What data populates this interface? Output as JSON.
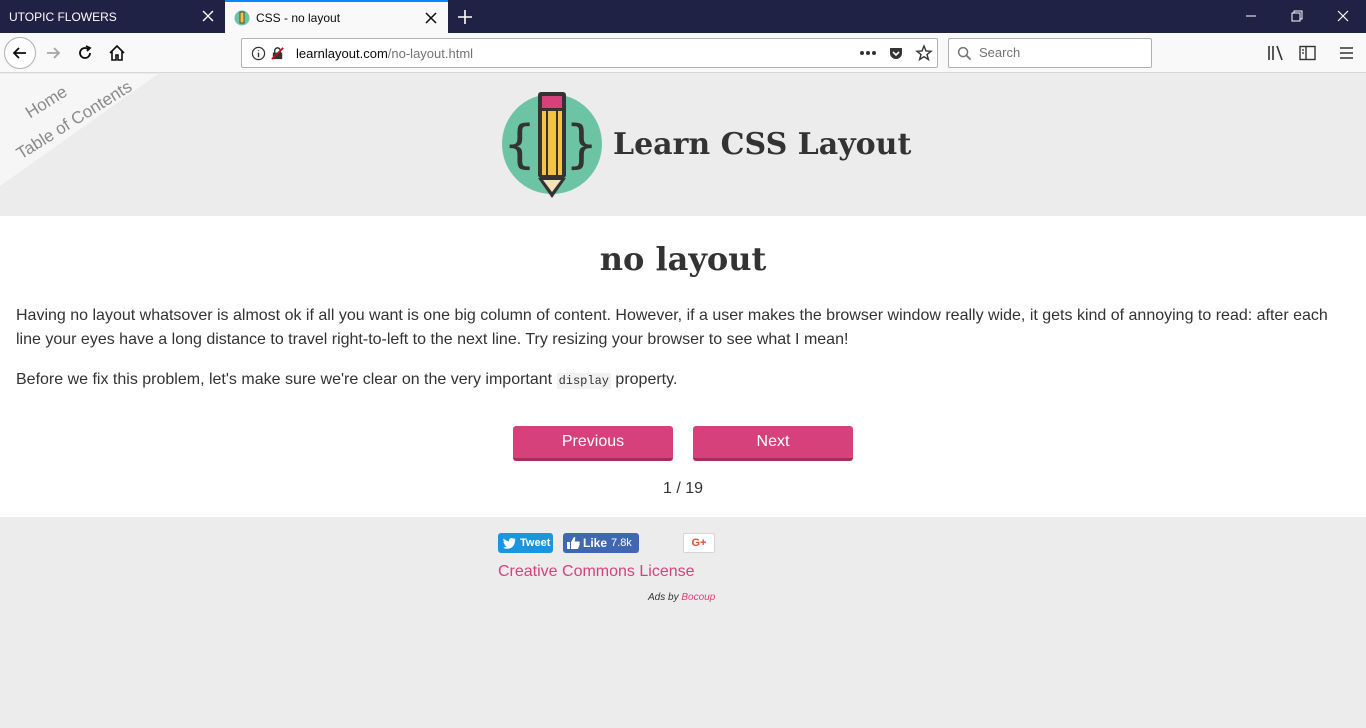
{
  "browser": {
    "tabs": [
      {
        "title": "UTOPIC FLOWERS",
        "active": false
      },
      {
        "title": "CSS - no layout",
        "active": true
      }
    ],
    "url": {
      "domain": "learnlayout.com",
      "path": "/no-layout.html"
    },
    "search_placeholder": "Search",
    "colors": {
      "tabbar": "#1f2145",
      "toolbar": "#f9f9fa",
      "active_tab_accent": "#0a84ff"
    }
  },
  "site": {
    "nav_links": [
      "Home",
      "Table of Contents"
    ],
    "logo_title": "Learn CSS Layout"
  },
  "article": {
    "title": "no layout",
    "paragraph1": "Having no layout whatsover is almost ok if all you want is one big column of content. However, if a user makes the browser window really wide, it gets kind of annoying to read: after each line your eyes have a long distance to travel right-to-left to the next line. Try resizing your browser to see what I mean!",
    "paragraph2_before": "Before we fix this problem, let's make sure we're clear on the very important ",
    "paragraph2_code": "display",
    "paragraph2_after": " property.",
    "prev_label": "Previous",
    "next_label": "Next",
    "pager": "1 / 19",
    "accent_color": "#d6417b"
  },
  "footer": {
    "tweet_label": "Tweet",
    "like_label": "Like",
    "like_count": "7.8k",
    "gplus_label": "G+",
    "license_link": "Creative Commons License",
    "ads_prefix": "Ads by ",
    "ads_link": "Bocoup"
  }
}
